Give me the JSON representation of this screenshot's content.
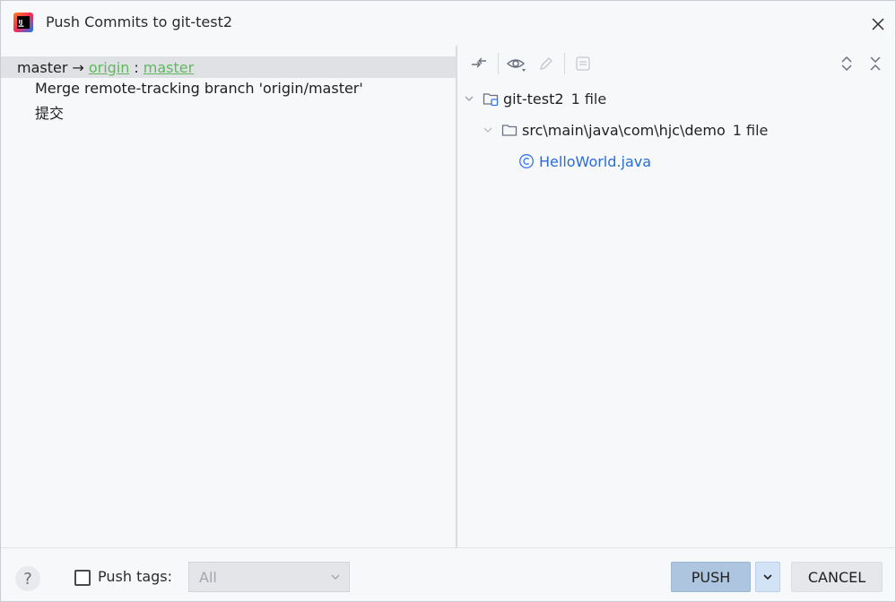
{
  "window": {
    "title": "Push Commits to git-test2"
  },
  "left": {
    "local_branch": "master",
    "arrow": "→",
    "remote": "origin",
    "separator": ":",
    "remote_branch": "master",
    "commits": [
      "Merge remote-tracking branch 'origin/master'",
      "提交"
    ]
  },
  "right": {
    "toolbar": {
      "icons": [
        "compare-arrows-icon",
        "eye-icon",
        "edit-icon",
        "show-diff-icon",
        "expand-all-icon",
        "collapse-all-icon"
      ]
    },
    "tree": {
      "root": {
        "name": "git-test2",
        "count": "1 file"
      },
      "folder": {
        "name": "src\\main\\java\\com\\hjc\\demo",
        "count": "1 file"
      },
      "file": {
        "name": "HelloWorld.java",
        "icon_glyph": "©"
      }
    }
  },
  "footer": {
    "help_label": "?",
    "push_tags_label": "Push tags:",
    "tags_value": "All",
    "push_label": "PUSH",
    "cancel_label": "CANCEL"
  },
  "colors": {
    "link_green": "#5fb85f",
    "file_blue": "#2a6bd6",
    "push_button": "#aec5e0",
    "selected_row": "#dfe1e5"
  }
}
